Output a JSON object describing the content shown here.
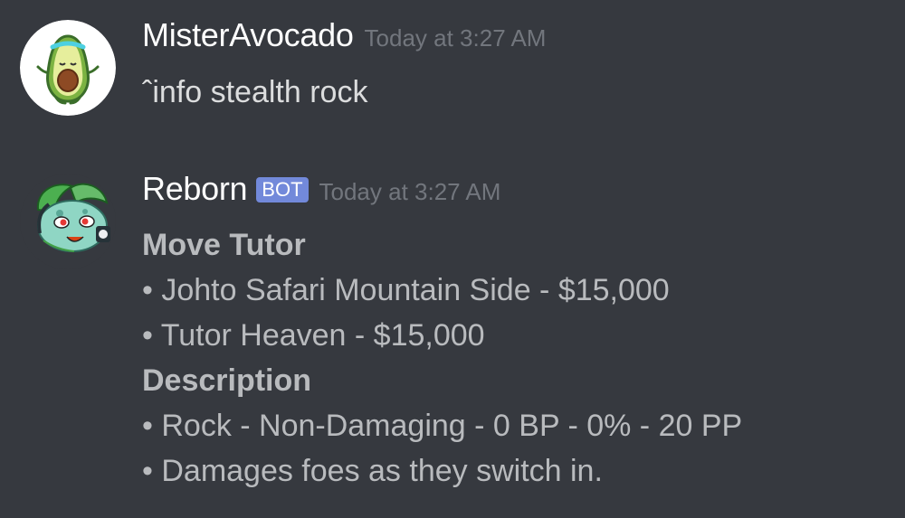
{
  "messages": [
    {
      "username": "MisterAvocado",
      "timestamp": "Today at 3:27 AM",
      "text": "ˆinfo stealth rock"
    },
    {
      "username": "Reborn",
      "badge": "BOT",
      "timestamp": "Today at 3:27 AM",
      "sections": [
        {
          "title": "Move Tutor",
          "lines": [
            "• Johto Safari Mountain Side - $15,000",
            "• Tutor Heaven - $15,000"
          ]
        },
        {
          "title": "Description",
          "lines": [
            "• Rock - Non-Damaging - 0 BP - 0% - 20 PP",
            "• Damages foes as they switch in."
          ]
        }
      ]
    }
  ],
  "colors": {
    "background": "#36393f",
    "username": "#ffffff",
    "timestamp": "#72767d",
    "bot_badge": "#7289da",
    "message_text": "#dcddde",
    "embed_text": "#b9bbbe"
  },
  "icons": {
    "avatar_1": "avocado-avatar-icon",
    "avatar_2": "bulbasaur-avatar-icon"
  }
}
